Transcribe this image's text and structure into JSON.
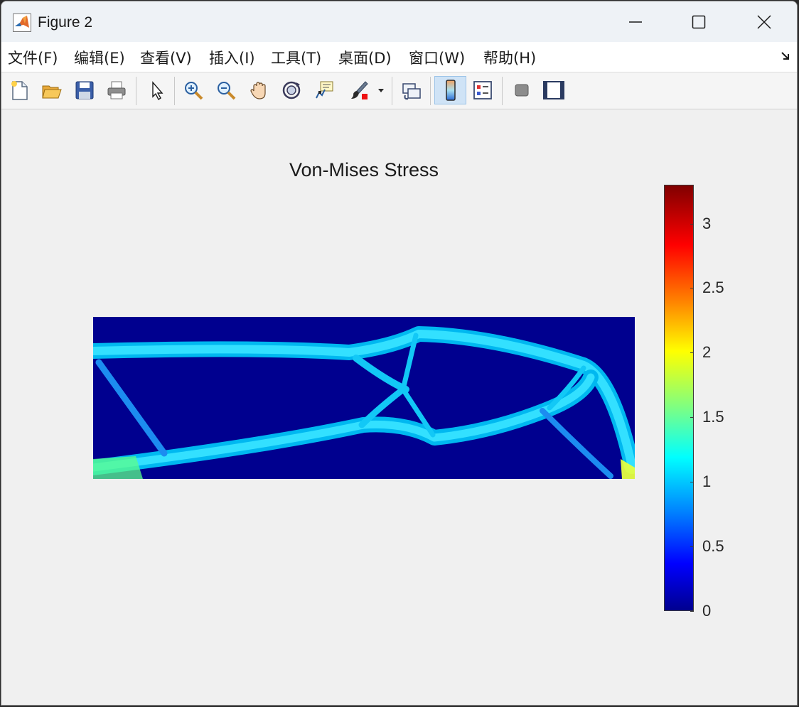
{
  "window": {
    "title": "Figure 2"
  },
  "menu": [
    "文件(F)",
    "编辑(E)",
    "查看(V)",
    "插入(I)",
    "工具(T)",
    "桌面(D)",
    "窗口(W)",
    "帮助(H)"
  ],
  "toolbar": [
    {
      "name": "new-figure-button",
      "icon": "new-file-icon"
    },
    {
      "name": "open-file-button",
      "icon": "folder-open-icon"
    },
    {
      "name": "save-figure-button",
      "icon": "save-icon"
    },
    {
      "name": "print-figure-button",
      "icon": "printer-icon"
    },
    {
      "name": "edit-plot-button",
      "icon": "arrow-cursor-icon"
    },
    {
      "name": "zoom-in-button",
      "icon": "zoom-in-icon"
    },
    {
      "name": "zoom-out-button",
      "icon": "zoom-out-icon"
    },
    {
      "name": "pan-button",
      "icon": "hand-icon"
    },
    {
      "name": "rotate-3d-button",
      "icon": "rotate-icon"
    },
    {
      "name": "data-cursor-button",
      "icon": "data-tip-icon"
    },
    {
      "name": "brush-button",
      "icon": "brush-icon"
    },
    {
      "name": "link-plot-button",
      "icon": "link-plot-icon"
    },
    {
      "name": "insert-colorbar-button",
      "icon": "colorbar-icon",
      "active": true
    },
    {
      "name": "insert-legend-button",
      "icon": "legend-icon"
    },
    {
      "name": "hide-plot-tools-button",
      "icon": "hide-tools-icon"
    },
    {
      "name": "show-plot-tools-button",
      "icon": "show-tools-icon"
    }
  ],
  "plot": {
    "title": "Von-Mises Stress"
  },
  "chart_data": {
    "type": "heatmap",
    "title": "Von-Mises Stress",
    "colormap": "jet",
    "colorbar": {
      "range": [
        0,
        3.3
      ],
      "ticks": [
        0,
        0.5,
        1,
        1.5,
        2,
        2.5,
        3
      ],
      "tick_labels": [
        "0",
        "0.5",
        "1",
        "1.5",
        "2",
        "2.5",
        "3"
      ]
    },
    "background_value": 0,
    "typical_member_value": 1.1,
    "peak_value": 3.3
  }
}
